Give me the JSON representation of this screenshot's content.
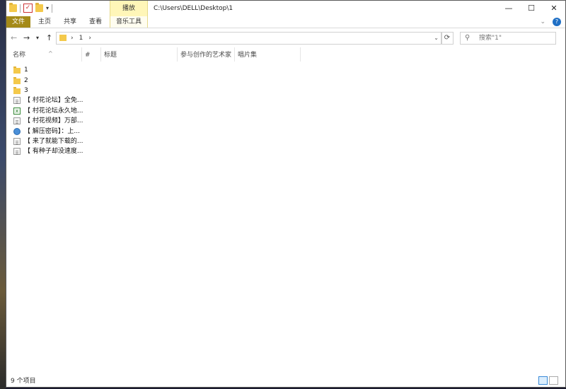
{
  "window": {
    "path_title": "C:\\Users\\DELL\\Desktop\\1",
    "context_tab": "播放",
    "controls": {
      "minimize": "—",
      "maximize": "☐",
      "close": "✕"
    }
  },
  "ribbon": {
    "tabs": [
      "文件",
      "主页",
      "共享",
      "查看",
      "音乐工具"
    ],
    "expand": "⌄"
  },
  "address": {
    "crumbs": [
      "›",
      "1",
      "›"
    ],
    "search_placeholder": "搜索\"1\""
  },
  "columns": [
    "名称",
    "#",
    "标题",
    "参与创作的艺术家",
    "唱片集"
  ],
  "files": [
    {
      "name": "1",
      "icon": "folder-icon"
    },
    {
      "name": "2",
      "icon": "folder-icon"
    },
    {
      "name": "3",
      "icon": "folder-icon"
    },
    {
      "name": "【 村花论坛】全免...",
      "icon": "text-document-icon"
    },
    {
      "name": "【 村花论坛永久地...",
      "icon": "excel-document-icon"
    },
    {
      "name": "【 村花视频】万部...",
      "icon": "text-document-icon"
    },
    {
      "name": "【 解压密码】：上...",
      "icon": "web-shortcut-icon"
    },
    {
      "name": "【 来了就能下载的...",
      "icon": "text-document-icon"
    },
    {
      "name": "【 有种子却没速度...",
      "icon": "text-document-icon"
    }
  ],
  "status": {
    "item_count": "9 个项目"
  }
}
